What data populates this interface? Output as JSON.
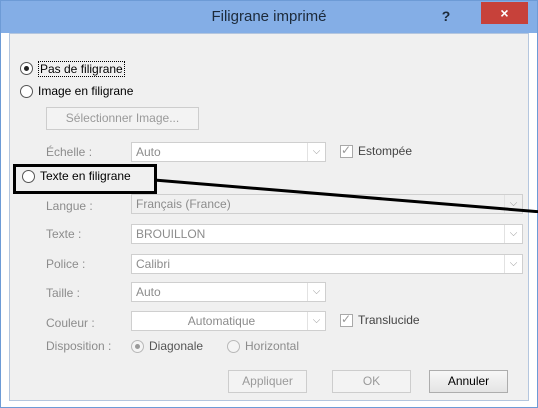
{
  "window": {
    "title": "Filigrane imprimé",
    "help_label": "?",
    "close_label": "×"
  },
  "options": {
    "no_watermark": "Pas de filigrane",
    "picture_watermark": "Image en filigrane",
    "text_watermark": "Texte en filigrane"
  },
  "picture": {
    "select_button": "Sélectionner Image...",
    "scale_label": "Échelle :",
    "scale_value": "Auto",
    "washout_label": "Estompée"
  },
  "text": {
    "language_label": "Langue :",
    "language_value": "Français (France)",
    "text_label": "Texte :",
    "text_value": "BROUILLON",
    "font_label": "Police :",
    "font_value": "Calibri",
    "size_label": "Taille :",
    "size_value": "Auto",
    "color_label": "Couleur :",
    "color_value": "Automatique",
    "semitransparent_label": "Translucide",
    "layout_label": "Disposition :",
    "diagonal_label": "Diagonale",
    "horizontal_label": "Horizontal"
  },
  "buttons": {
    "apply": "Appliquer",
    "ok": "OK",
    "cancel": "Annuler"
  },
  "colors": {
    "titlebar": "#84aee6",
    "close": "#c7413a",
    "callout": "#000000"
  }
}
